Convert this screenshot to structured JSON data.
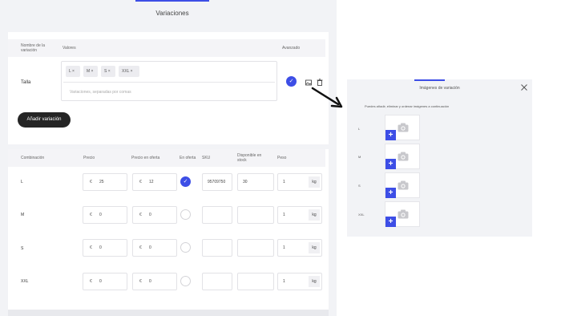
{
  "left": {
    "title": "Variaciones",
    "header": {
      "name_col": "Nombre de la variación",
      "values_col": "Valores",
      "advanced_col": "Avanzado"
    },
    "variation": {
      "name": "Talla",
      "chips": [
        "L ×",
        "M ×",
        "S ×",
        "XXL ×"
      ],
      "placeholder": "Variaciones, separadas por comas"
    },
    "add_button": "Añadir variación",
    "table": {
      "headers": [
        "Combinación",
        "Precio",
        "Precio en oferta",
        "En oferta",
        "SKU",
        "Disponible en stock",
        "Peso"
      ],
      "currency": "€",
      "unit": "kg",
      "rows": [
        {
          "name": "L",
          "price": "25",
          "sale": "12",
          "on_sale": true,
          "sku": "95709750",
          "stock": "30",
          "weight": "1"
        },
        {
          "name": "M",
          "price": "0",
          "sale": "0",
          "on_sale": false,
          "sku": "",
          "stock": "",
          "weight": "1"
        },
        {
          "name": "S",
          "price": "0",
          "sale": "0",
          "on_sale": false,
          "sku": "",
          "stock": "",
          "weight": "1"
        },
        {
          "name": "XXL",
          "price": "0",
          "sale": "0",
          "on_sale": false,
          "sku": "",
          "stock": "",
          "weight": "1"
        }
      ]
    }
  },
  "right": {
    "title": "Imágenes de variación",
    "description": "Puedes añadir, eliminar y ordenar imágenes a continuación",
    "rows": [
      "L",
      "M",
      "S",
      "XXL"
    ]
  },
  "colors": {
    "accent": "#3d4ee6",
    "button_dark": "#252525",
    "panel_bg": "#f2f3f6"
  },
  "icons": [
    "check-icon",
    "image-icon",
    "trash-icon",
    "arrow-icon",
    "close-icon",
    "camera-icon",
    "plus-icon"
  ]
}
